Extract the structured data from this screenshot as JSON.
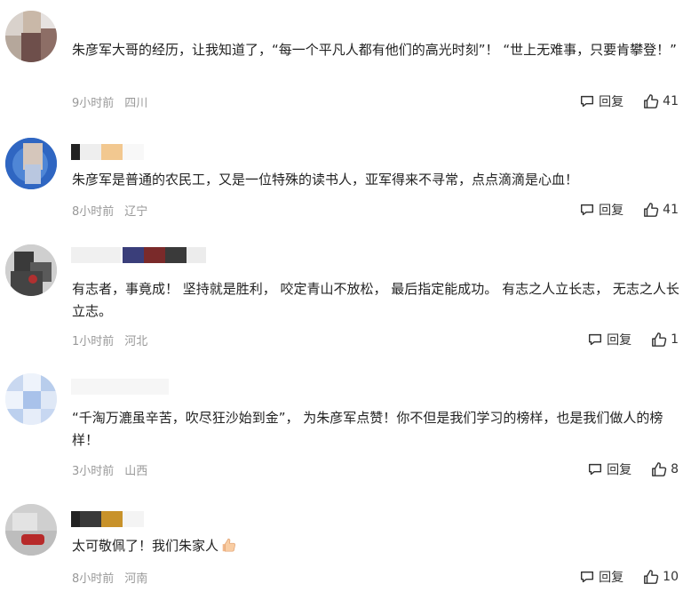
{
  "comments": [
    {
      "text": "朱彦军大哥的经历，让我知道了，“每一个平凡人都有他们的高光时刻”！ “世上无难事，只要肯攀登！”",
      "time": "9小时前",
      "location": "四川",
      "reply_label": "回复",
      "likes": "41"
    },
    {
      "text": "朱彦军是普通的农民工，又是一位特殊的读书人，亚军得来不寻常，点点滴滴是心血！",
      "time": "8小时前",
      "location": "辽宁",
      "reply_label": "回复",
      "likes": "41"
    },
    {
      "text": "有志者，事竟成！ 坚持就是胜利， 咬定青山不放松， 最后指定能成功。 有志之人立长志， 无志之人长立志。",
      "time": "1小时前",
      "location": "河北",
      "reply_label": "回复",
      "likes": "1"
    },
    {
      "text": "“千淘万漉虽辛苦，吹尽狂沙始到金”， 为朱彦军点赞！你不但是我们学习的榜样，也是我们做人的榜样！",
      "time": "3小时前",
      "location": "山西",
      "reply_label": "回复",
      "likes": "8"
    },
    {
      "text": "太可敬佩了！我们朱家人",
      "emoji": "thumbs-up-emoji",
      "time": "8小时前",
      "location": "河南",
      "reply_label": "回复",
      "likes": "10"
    }
  ],
  "icons": {
    "reply": "comment-bubble-icon",
    "like": "thumbs-up-icon"
  },
  "colors": {
    "text": "#222222",
    "meta": "#999999",
    "action": "#333333"
  }
}
